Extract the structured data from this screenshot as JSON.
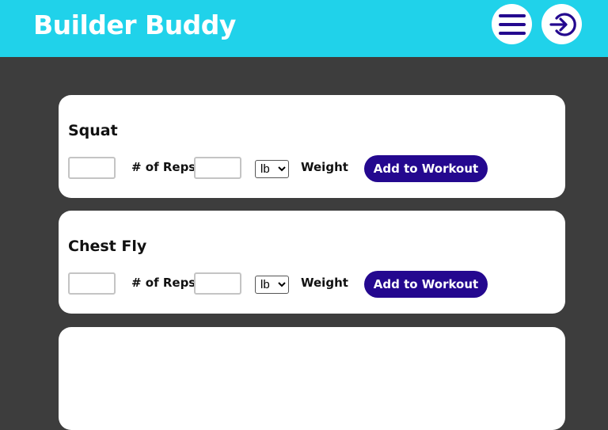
{
  "app": {
    "title": "Builder Buddy"
  },
  "header": {
    "menu_icon": "hamburger-menu-icon",
    "login_icon": "login-icon"
  },
  "labels": {
    "reps": "# of Reps",
    "weight": "Weight",
    "add_button": "Add to Workout",
    "unit_options": [
      "lb"
    ],
    "unit_selected": "lb"
  },
  "exercises": [
    {
      "name": "Squat",
      "reps": "",
      "weight": ""
    },
    {
      "name": "Chest Fly",
      "reps": "",
      "weight": ""
    },
    {
      "name": "",
      "reps": "",
      "weight": ""
    }
  ],
  "colors": {
    "header": "#20d2ea",
    "background": "#3d3d3d",
    "button": "#24088f",
    "icon": "#24088f"
  }
}
